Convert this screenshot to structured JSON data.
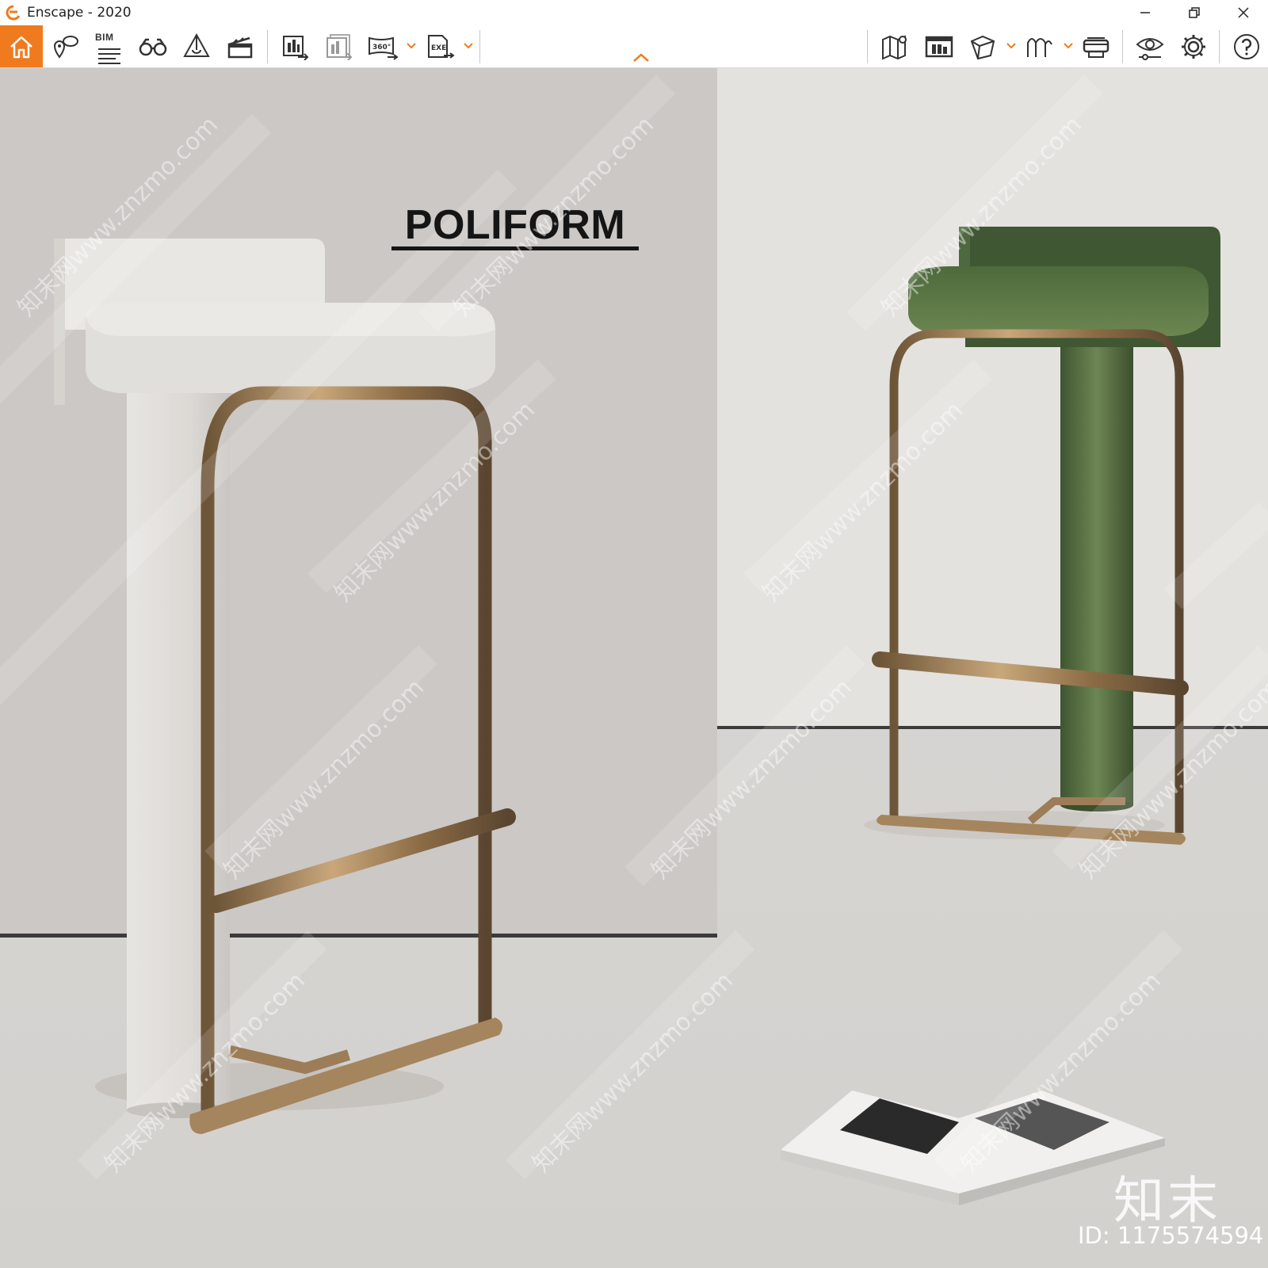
{
  "window": {
    "title": "Enscape - 2020",
    "accent_color": "#f07a1e",
    "controls": [
      "minimize-icon",
      "restore-icon",
      "close-icon"
    ]
  },
  "toolbar": {
    "left_buttons": [
      {
        "name": "home-button",
        "icon": "home-icon"
      },
      {
        "name": "views-button",
        "icon": "location-pin-icon"
      },
      {
        "name": "bim-button",
        "icon": "bim-list-icon",
        "label": "BIM"
      },
      {
        "name": "walk-mode-button",
        "icon": "binoculars-icon"
      },
      {
        "name": "material-button",
        "icon": "cone-icon"
      },
      {
        "name": "video-editor-button",
        "icon": "clapperboard-icon"
      },
      {
        "name": "screenshot-button",
        "icon": "export-image-icon"
      },
      {
        "name": "batch-render-button",
        "icon": "batch-export-icon"
      },
      {
        "name": "panorama-button",
        "icon": "panorama-360-icon",
        "label": "360°"
      },
      {
        "name": "exe-export-button",
        "icon": "exe-export-icon",
        "label": "EXE"
      }
    ],
    "right_buttons": [
      {
        "name": "map-button",
        "icon": "map-icon"
      },
      {
        "name": "asset-library-button",
        "icon": "asset-library-icon"
      },
      {
        "name": "view-cube-button",
        "icon": "cube-icon"
      },
      {
        "name": "composition-button",
        "icon": "wave-icon"
      },
      {
        "name": "vr-button",
        "icon": "vr-headset-icon"
      },
      {
        "name": "visual-settings-button",
        "icon": "eye-settings-icon"
      },
      {
        "name": "settings-button",
        "icon": "gear-icon"
      },
      {
        "name": "help-button",
        "icon": "help-icon"
      }
    ]
  },
  "render": {
    "brand": "POLIFORM",
    "watermark": "知末网www.znzmo.com",
    "logo": "知末",
    "image_id": "ID: 1175574594"
  }
}
